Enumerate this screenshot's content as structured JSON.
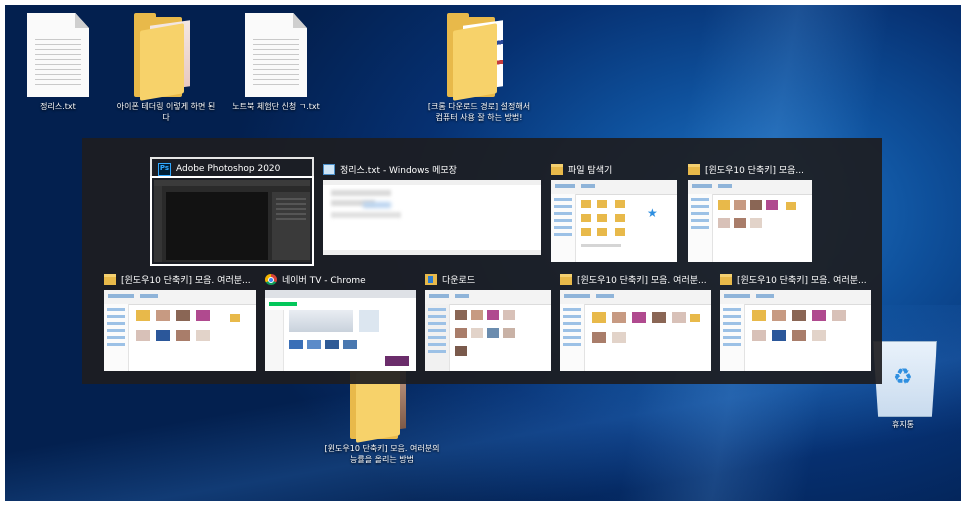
{
  "desktop": {
    "icons": [
      {
        "label": "정리스.txt",
        "icon": "text-file-icon"
      },
      {
        "label": "아이폰 테더링 이렇게 하면 된다",
        "icon": "folder-icon"
      },
      {
        "label": "노트북 체험단 신청 ㄱ.txt",
        "icon": "text-file-icon"
      },
      {
        "label": "[크롬 다운로드 경로] 설정해서 컴퓨터 사용 잘 하는 방법!",
        "icon": "folder-icon"
      },
      {
        "label": "[윈도우10 단축키] 모음. 여러분의 능률을 올리는 방법",
        "icon": "folder-icon"
      },
      {
        "label": "휴지통",
        "icon": "recycle-bin-icon"
      }
    ]
  },
  "switcher": {
    "windows": [
      {
        "title": "Adobe Photoshop 2020",
        "app_icon": "photoshop-icon",
        "selected": true,
        "thumb": "photoshop"
      },
      {
        "title": "정리스.txt - Windows 메모장",
        "app_icon": "notepad-icon",
        "selected": false,
        "thumb": "notepad"
      },
      {
        "title": "파일 탐색기",
        "app_icon": "folder-icon",
        "selected": false,
        "thumb": "explorer-quick"
      },
      {
        "title": "[윈도우10 단축키] 모음...",
        "app_icon": "folder-icon",
        "selected": false,
        "thumb": "explorer-images"
      },
      {
        "title": "[윈도우10 단축키] 모음. 여러분...",
        "app_icon": "folder-icon",
        "selected": false,
        "thumb": "explorer-images"
      },
      {
        "title": "네이버 TV - Chrome",
        "app_icon": "chrome-icon",
        "selected": false,
        "thumb": "chrome"
      },
      {
        "title": "다운로드",
        "app_icon": "download-folder-icon",
        "selected": false,
        "thumb": "explorer-images"
      },
      {
        "title": "[윈도우10 단축키] 모음. 여러분...",
        "app_icon": "folder-icon",
        "selected": false,
        "thumb": "explorer-images"
      },
      {
        "title": "[윈도우10 단축키] 모음. 여러분...",
        "app_icon": "folder-icon",
        "selected": false,
        "thumb": "explorer-images"
      }
    ]
  },
  "colors": {
    "switcher_bg": "#1d1d21",
    "desktop_blue": "#0e4f9a",
    "folder_yellow": "#e8b94a"
  }
}
